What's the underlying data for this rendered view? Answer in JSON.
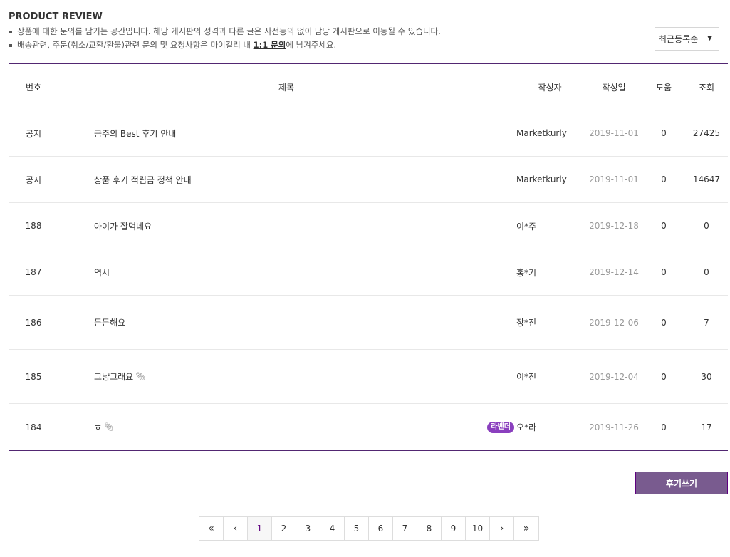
{
  "header": {
    "title": "PRODUCT REVIEW",
    "notice_1": "상품에 대한 문의를 남기는 공간입니다. 해당 게시판의 성격과 다른 글은 사전동의 없이 담당 게시판으로 이동될 수 있습니다.",
    "notice_2_prefix": "배송관련, 주문(취소/교환/환불)관련 문의 및 요청사항은 마이컬리 내 ",
    "notice_2_link": "1:1 문의",
    "notice_2_suffix": "에 남겨주세요."
  },
  "sort": {
    "selected": "최근등록순",
    "arrow": "▼"
  },
  "table": {
    "headers": {
      "no": "번호",
      "title": "제목",
      "writer": "작성자",
      "date": "작성일",
      "help": "도움",
      "views": "조회"
    },
    "rows": [
      {
        "no": "공지",
        "title": "금주의 Best 후기 안내",
        "writer": "Marketkurly",
        "date": "2019-11-01",
        "help": "0",
        "views": "27425"
      },
      {
        "no": "공지",
        "title": "상품 후기 적립금 정책 안내",
        "writer": "Marketkurly",
        "date": "2019-11-01",
        "help": "0",
        "views": "14647"
      },
      {
        "no": "188",
        "title": "아이가 잘먹네요",
        "writer": "이*주",
        "date": "2019-12-18",
        "help": "0",
        "views": "0"
      },
      {
        "no": "187",
        "title": "역시",
        "writer": "홍*기",
        "date": "2019-12-14",
        "help": "0",
        "views": "0"
      },
      {
        "no": "186",
        "title": "든든해요",
        "writer": "장*진",
        "date": "2019-12-06",
        "help": "0",
        "views": "7"
      },
      {
        "no": "185",
        "title": "그냥그래요",
        "writer": "이*진",
        "date": "2019-12-04",
        "help": "0",
        "views": "30"
      },
      {
        "no": "184",
        "title": "ㅎ",
        "writer": "오*라",
        "date": "2019-11-26",
        "help": "0",
        "views": "17",
        "badge": "라벤더"
      }
    ]
  },
  "write_button": "후기쓰기",
  "pagination": {
    "first": "«",
    "prev": "‹",
    "next": "›",
    "last": "»",
    "pages": [
      "1",
      "2",
      "3",
      "4",
      "5",
      "6",
      "7",
      "8",
      "9",
      "10"
    ],
    "current": "1"
  },
  "colors": {
    "accent": "#522772",
    "badge": "#8a3fbe",
    "button": "#795b8f"
  }
}
